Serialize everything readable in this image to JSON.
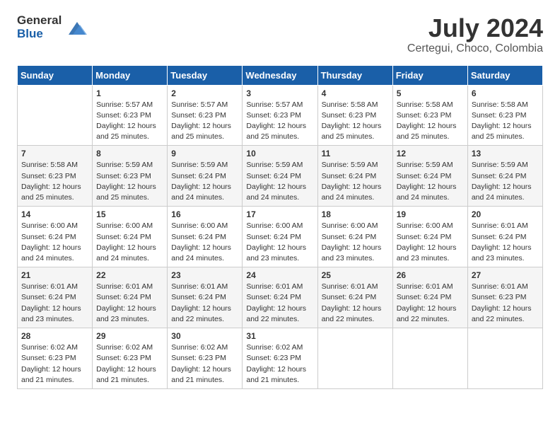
{
  "logo": {
    "text_general": "General",
    "text_blue": "Blue"
  },
  "title": "July 2024",
  "subtitle": "Certegui, Choco, Colombia",
  "days_of_week": [
    "Sunday",
    "Monday",
    "Tuesday",
    "Wednesday",
    "Thursday",
    "Friday",
    "Saturday"
  ],
  "weeks": [
    [
      {
        "day": "",
        "info": ""
      },
      {
        "day": "1",
        "info": "Sunrise: 5:57 AM\nSunset: 6:23 PM\nDaylight: 12 hours\nand 25 minutes."
      },
      {
        "day": "2",
        "info": "Sunrise: 5:57 AM\nSunset: 6:23 PM\nDaylight: 12 hours\nand 25 minutes."
      },
      {
        "day": "3",
        "info": "Sunrise: 5:57 AM\nSunset: 6:23 PM\nDaylight: 12 hours\nand 25 minutes."
      },
      {
        "day": "4",
        "info": "Sunrise: 5:58 AM\nSunset: 6:23 PM\nDaylight: 12 hours\nand 25 minutes."
      },
      {
        "day": "5",
        "info": "Sunrise: 5:58 AM\nSunset: 6:23 PM\nDaylight: 12 hours\nand 25 minutes."
      },
      {
        "day": "6",
        "info": "Sunrise: 5:58 AM\nSunset: 6:23 PM\nDaylight: 12 hours\nand 25 minutes."
      }
    ],
    [
      {
        "day": "7",
        "info": "Sunrise: 5:58 AM\nSunset: 6:23 PM\nDaylight: 12 hours\nand 25 minutes."
      },
      {
        "day": "8",
        "info": "Sunrise: 5:59 AM\nSunset: 6:23 PM\nDaylight: 12 hours\nand 25 minutes."
      },
      {
        "day": "9",
        "info": "Sunrise: 5:59 AM\nSunset: 6:24 PM\nDaylight: 12 hours\nand 24 minutes."
      },
      {
        "day": "10",
        "info": "Sunrise: 5:59 AM\nSunset: 6:24 PM\nDaylight: 12 hours\nand 24 minutes."
      },
      {
        "day": "11",
        "info": "Sunrise: 5:59 AM\nSunset: 6:24 PM\nDaylight: 12 hours\nand 24 minutes."
      },
      {
        "day": "12",
        "info": "Sunrise: 5:59 AM\nSunset: 6:24 PM\nDaylight: 12 hours\nand 24 minutes."
      },
      {
        "day": "13",
        "info": "Sunrise: 5:59 AM\nSunset: 6:24 PM\nDaylight: 12 hours\nand 24 minutes."
      }
    ],
    [
      {
        "day": "14",
        "info": "Sunrise: 6:00 AM\nSunset: 6:24 PM\nDaylight: 12 hours\nand 24 minutes."
      },
      {
        "day": "15",
        "info": "Sunrise: 6:00 AM\nSunset: 6:24 PM\nDaylight: 12 hours\nand 24 minutes."
      },
      {
        "day": "16",
        "info": "Sunrise: 6:00 AM\nSunset: 6:24 PM\nDaylight: 12 hours\nand 24 minutes."
      },
      {
        "day": "17",
        "info": "Sunrise: 6:00 AM\nSunset: 6:24 PM\nDaylight: 12 hours\nand 23 minutes."
      },
      {
        "day": "18",
        "info": "Sunrise: 6:00 AM\nSunset: 6:24 PM\nDaylight: 12 hours\nand 23 minutes."
      },
      {
        "day": "19",
        "info": "Sunrise: 6:00 AM\nSunset: 6:24 PM\nDaylight: 12 hours\nand 23 minutes."
      },
      {
        "day": "20",
        "info": "Sunrise: 6:01 AM\nSunset: 6:24 PM\nDaylight: 12 hours\nand 23 minutes."
      }
    ],
    [
      {
        "day": "21",
        "info": "Sunrise: 6:01 AM\nSunset: 6:24 PM\nDaylight: 12 hours\nand 23 minutes."
      },
      {
        "day": "22",
        "info": "Sunrise: 6:01 AM\nSunset: 6:24 PM\nDaylight: 12 hours\nand 23 minutes."
      },
      {
        "day": "23",
        "info": "Sunrise: 6:01 AM\nSunset: 6:24 PM\nDaylight: 12 hours\nand 22 minutes."
      },
      {
        "day": "24",
        "info": "Sunrise: 6:01 AM\nSunset: 6:24 PM\nDaylight: 12 hours\nand 22 minutes."
      },
      {
        "day": "25",
        "info": "Sunrise: 6:01 AM\nSunset: 6:24 PM\nDaylight: 12 hours\nand 22 minutes."
      },
      {
        "day": "26",
        "info": "Sunrise: 6:01 AM\nSunset: 6:24 PM\nDaylight: 12 hours\nand 22 minutes."
      },
      {
        "day": "27",
        "info": "Sunrise: 6:01 AM\nSunset: 6:23 PM\nDaylight: 12 hours\nand 22 minutes."
      }
    ],
    [
      {
        "day": "28",
        "info": "Sunrise: 6:02 AM\nSunset: 6:23 PM\nDaylight: 12 hours\nand 21 minutes."
      },
      {
        "day": "29",
        "info": "Sunrise: 6:02 AM\nSunset: 6:23 PM\nDaylight: 12 hours\nand 21 minutes."
      },
      {
        "day": "30",
        "info": "Sunrise: 6:02 AM\nSunset: 6:23 PM\nDaylight: 12 hours\nand 21 minutes."
      },
      {
        "day": "31",
        "info": "Sunrise: 6:02 AM\nSunset: 6:23 PM\nDaylight: 12 hours\nand 21 minutes."
      },
      {
        "day": "",
        "info": ""
      },
      {
        "day": "",
        "info": ""
      },
      {
        "day": "",
        "info": ""
      }
    ]
  ]
}
